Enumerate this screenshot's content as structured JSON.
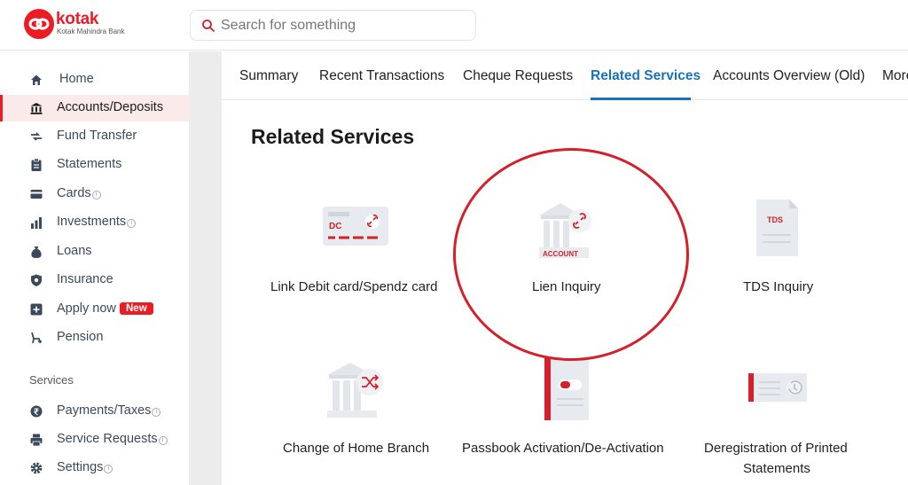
{
  "header": {
    "brand": "kotak",
    "brand_sub": "Kotak Mahindra Bank",
    "search_placeholder": "Search for something"
  },
  "sidebar": {
    "items": [
      {
        "label": "Home",
        "icon": "home-icon",
        "active": false
      },
      {
        "label": "Accounts/Deposits",
        "icon": "bank-icon",
        "active": true
      },
      {
        "label": "Fund Transfer",
        "icon": "transfer-icon",
        "active": false
      },
      {
        "label": "Statements",
        "icon": "clipboard-icon",
        "active": false
      },
      {
        "label": "Cards",
        "icon": "card-icon",
        "active": false,
        "info": true
      },
      {
        "label": "Investments",
        "icon": "bar-chart-icon",
        "active": false,
        "info": true
      },
      {
        "label": "Loans",
        "icon": "money-bag-icon",
        "active": false
      },
      {
        "label": "Insurance",
        "icon": "shield-icon",
        "active": false
      },
      {
        "label": "Apply now",
        "icon": "apply-icon",
        "active": false,
        "badge": "New"
      },
      {
        "label": "Pension",
        "icon": "pension-icon",
        "active": false
      }
    ],
    "services_label": "Services",
    "services": [
      {
        "label": "Payments/Taxes",
        "icon": "rupee-icon",
        "info": true
      },
      {
        "label": "Service Requests",
        "icon": "printer-icon",
        "info": true
      },
      {
        "label": "Settings",
        "icon": "gear-icon",
        "info": true
      }
    ],
    "info_glyph": "i"
  },
  "tabs": [
    {
      "label": "Summary",
      "active": false
    },
    {
      "label": "Recent Transactions",
      "active": false
    },
    {
      "label": "Cheque Requests",
      "active": false
    },
    {
      "label": "Related Services",
      "active": true
    },
    {
      "label": "Accounts Overview (Old)",
      "active": false
    },
    {
      "label": "More",
      "active": false
    }
  ],
  "main": {
    "title": "Related Services",
    "services": [
      {
        "label": "Link Debit card/Spendz card",
        "icon": "debit-card-link-icon",
        "icon_text": "DC"
      },
      {
        "label": "Lien Inquiry",
        "icon": "account-link-icon",
        "icon_text": "ACCOUNT"
      },
      {
        "label": "TDS Inquiry",
        "icon": "tds-document-icon",
        "icon_text": "TDS"
      },
      {
        "label": "Change of Home Branch",
        "icon": "branch-shuffle-icon"
      },
      {
        "label": "Passbook Activation/De-Activation",
        "icon": "passbook-toggle-icon"
      },
      {
        "label": "Deregistration of Printed Statements",
        "label_line1": "Deregistration of Printed",
        "label_line2": "Statements",
        "icon": "statement-history-icon"
      }
    ]
  },
  "colors": {
    "brand_red": "#ed1c24",
    "active_tab_blue": "#1a73b5",
    "highlight_circle": "#d4202a"
  }
}
